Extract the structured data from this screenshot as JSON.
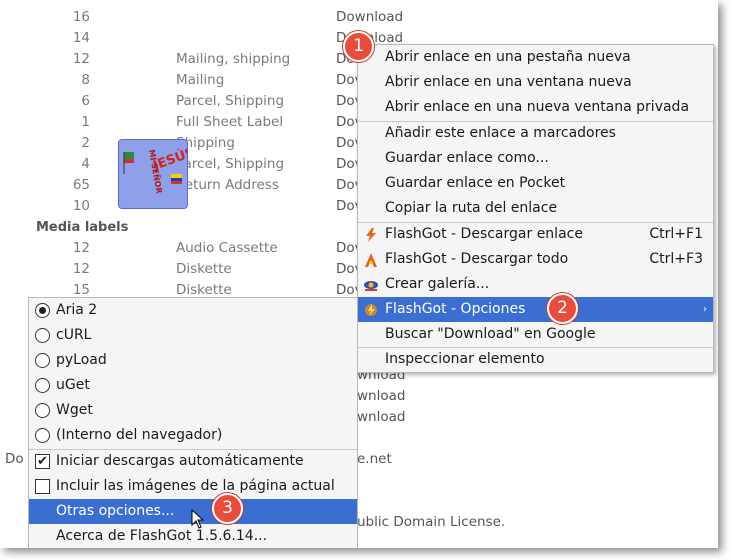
{
  "rows": [
    {
      "num": "16",
      "label": "",
      "dl": "Download"
    },
    {
      "num": "14",
      "label": "",
      "dl": "Download"
    },
    {
      "num": "12",
      "label": "Mailing, shipping",
      "dl": "Dov"
    },
    {
      "num": "8",
      "label": "Mailing",
      "dl": "Dov"
    },
    {
      "num": "6",
      "label": "Parcel, Shipping",
      "dl": "Dov"
    },
    {
      "num": "1",
      "label": "Full Sheet Label",
      "dl": "Dov"
    },
    {
      "num": "2",
      "label": "Shipping",
      "dl": "Dov"
    },
    {
      "num": "4",
      "label": "Parcel, Shipping",
      "dl": "Dov"
    },
    {
      "num": "65",
      "label": "Return Address",
      "dl": "Dov"
    },
    {
      "num": "10",
      "label": "",
      "dl": "Dov"
    }
  ],
  "section_header": "Media labels",
  "media_rows": [
    {
      "num": "12",
      "label": "Audio Cassette",
      "dl": "Dov"
    },
    {
      "num": "12",
      "label": "Diskette",
      "dl": "Dov"
    },
    {
      "num": "15",
      "label": "Diskette",
      "dl": "Dov"
    }
  ],
  "partials": {
    "dl1": "wnload",
    "dl2": "wnload",
    "dl3": "wnload",
    "left_text": "Do l",
    "site": "e.net",
    "license": "ublic Domain License."
  },
  "logo_text": "MISENOR JESÚS",
  "context_menu": {
    "items": [
      {
        "label": "Abrir enlace en una pestaña nueva"
      },
      {
        "label": "Abrir enlace en una ventana nueva"
      },
      {
        "label": "Abrir enlace en una nueva ventana privada"
      },
      {
        "label": "Añadir este enlace a marcadores"
      },
      {
        "label": "Guardar enlace como..."
      },
      {
        "label": "Guardar enlace en Pocket"
      },
      {
        "label": "Copiar la ruta del enlace"
      },
      {
        "label": "FlashGot - Descargar enlace",
        "shortcut": "Ctrl+F1"
      },
      {
        "label": "FlashGot - Descargar todo",
        "shortcut": "Ctrl+F3"
      },
      {
        "label": "Crear galería..."
      },
      {
        "label": "FlashGot - Opciones"
      },
      {
        "label": "Buscar \"Download\" en Google"
      },
      {
        "label": "Inspeccionar elemento"
      }
    ],
    "submenu_arrow": "›"
  },
  "submenu": {
    "radios": [
      {
        "label": "Aria 2",
        "checked": true
      },
      {
        "label": "cURL",
        "checked": false
      },
      {
        "label": "pyLoad",
        "checked": false
      },
      {
        "label": "uGet",
        "checked": false
      },
      {
        "label": "Wget",
        "checked": false
      },
      {
        "label": "(Interno del navegador)",
        "checked": false
      }
    ],
    "checkboxes": [
      {
        "label": "Iniciar descargas automáticamente",
        "checked": true
      },
      {
        "label": "Incluir las imágenes de la página actual",
        "checked": false
      }
    ],
    "other_options": "Otras opciones...",
    "about": "Acerca de FlashGot 1.5.6.14..."
  },
  "badges": {
    "b1": "1",
    "b2": "2",
    "b3": "3"
  },
  "colors": {
    "highlight": "#3a6fd1",
    "badge": "#e74c3c"
  }
}
